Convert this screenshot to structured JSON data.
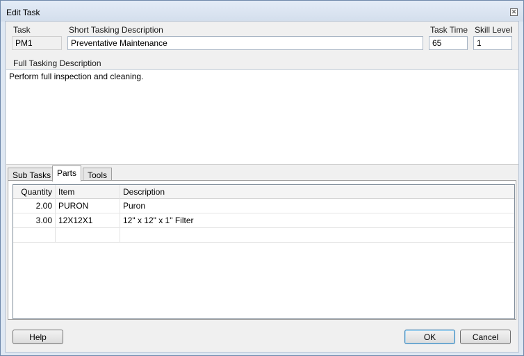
{
  "window": {
    "title": "Edit Task",
    "close_glyph": "✕"
  },
  "task": {
    "task_label": "Task",
    "task_value": "PM1",
    "short_desc_label": "Short Tasking Description",
    "short_desc_value": "Preventative Maintenance",
    "task_time_label": "Task Time",
    "task_time_value": "65",
    "skill_level_label": "Skill Level",
    "skill_level_value": "1",
    "full_desc_label": "Full Tasking Description",
    "full_desc_value": "Perform full inspection and cleaning."
  },
  "tabs": [
    {
      "label": "Sub Tasks",
      "active": false
    },
    {
      "label": "Parts",
      "active": true
    },
    {
      "label": "Tools",
      "active": false
    }
  ],
  "parts_grid": {
    "headers": [
      "Quantity",
      "Item",
      "Description"
    ],
    "rows": [
      [
        "2.00",
        "PURON",
        "Puron"
      ],
      [
        "3.00",
        "12X12X1",
        "12\" x 12\" x 1\" Filter"
      ],
      [
        "",
        "",
        ""
      ]
    ]
  },
  "buttons": {
    "help": "Help",
    "ok": "OK",
    "cancel": "Cancel"
  }
}
